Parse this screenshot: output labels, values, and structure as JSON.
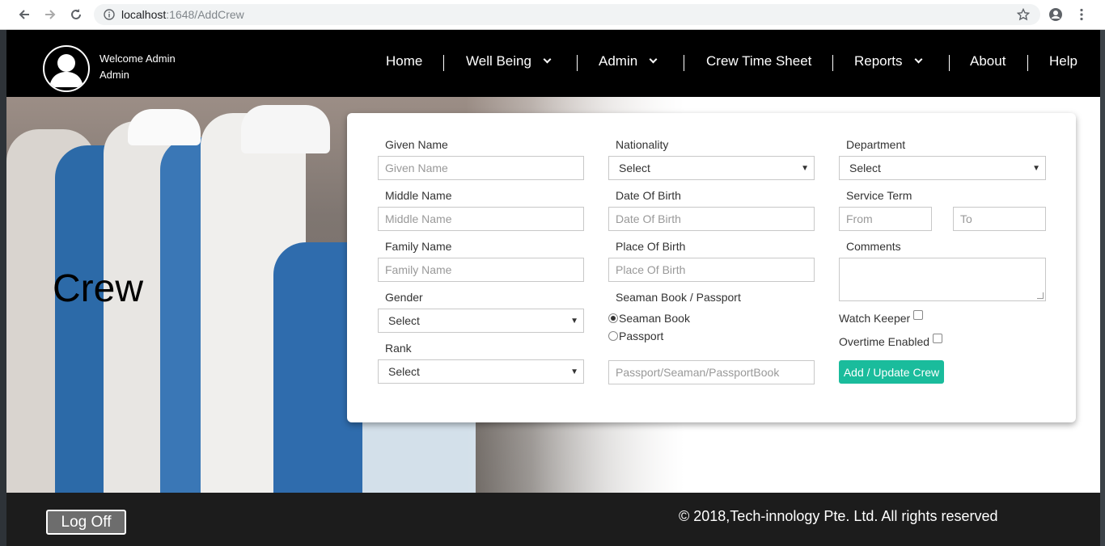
{
  "browser": {
    "url_host": "localhost",
    "url_path": ":1648/AddCrew"
  },
  "header": {
    "welcome_line1": "Welcome Admin",
    "welcome_line2": "Admin",
    "menu": {
      "home": "Home",
      "well_being": "Well Being",
      "admin": "Admin",
      "crew_time_sheet": "Crew Time Sheet",
      "reports": "Reports",
      "about": "About",
      "help": "Help"
    }
  },
  "hero": {
    "title": "Crew"
  },
  "form": {
    "given_name": {
      "label": "Given Name",
      "placeholder": "Given Name"
    },
    "middle_name": {
      "label": "Middle Name",
      "placeholder": "Middle Name"
    },
    "family_name": {
      "label": "Family Name",
      "placeholder": "Family Name"
    },
    "gender": {
      "label": "Gender",
      "selected": "Select"
    },
    "rank": {
      "label": "Rank",
      "selected": "Select"
    },
    "nationality": {
      "label": "Nationality",
      "selected": "Select"
    },
    "date_of_birth": {
      "label": "Date Of Birth",
      "placeholder": "Date Of Birth"
    },
    "place_of_birth": {
      "label": "Place Of Birth",
      "placeholder": "Place Of Birth"
    },
    "document_type": {
      "label": "Seaman Book / Passport",
      "option_seaman": "Seaman Book",
      "option_passport": "Passport",
      "selected": "Seaman Book"
    },
    "document_number": {
      "placeholder": "Passport/Seaman/PassportBook"
    },
    "department": {
      "label": "Department",
      "selected": "Select"
    },
    "service_term": {
      "label": "Service Term",
      "from_placeholder": "From",
      "to_placeholder": "To"
    },
    "comments": {
      "label": "Comments"
    },
    "watch_keeper": {
      "label": "Watch Keeper",
      "checked": false
    },
    "overtime_enabled": {
      "label": "Overtime Enabled",
      "checked": false
    },
    "submit_label": "Add / Update Crew"
  },
  "footer": {
    "logoff_label": "Log Off",
    "copyright": "© 2018,Tech-innology Pte. Ltd. All rights reserved"
  }
}
